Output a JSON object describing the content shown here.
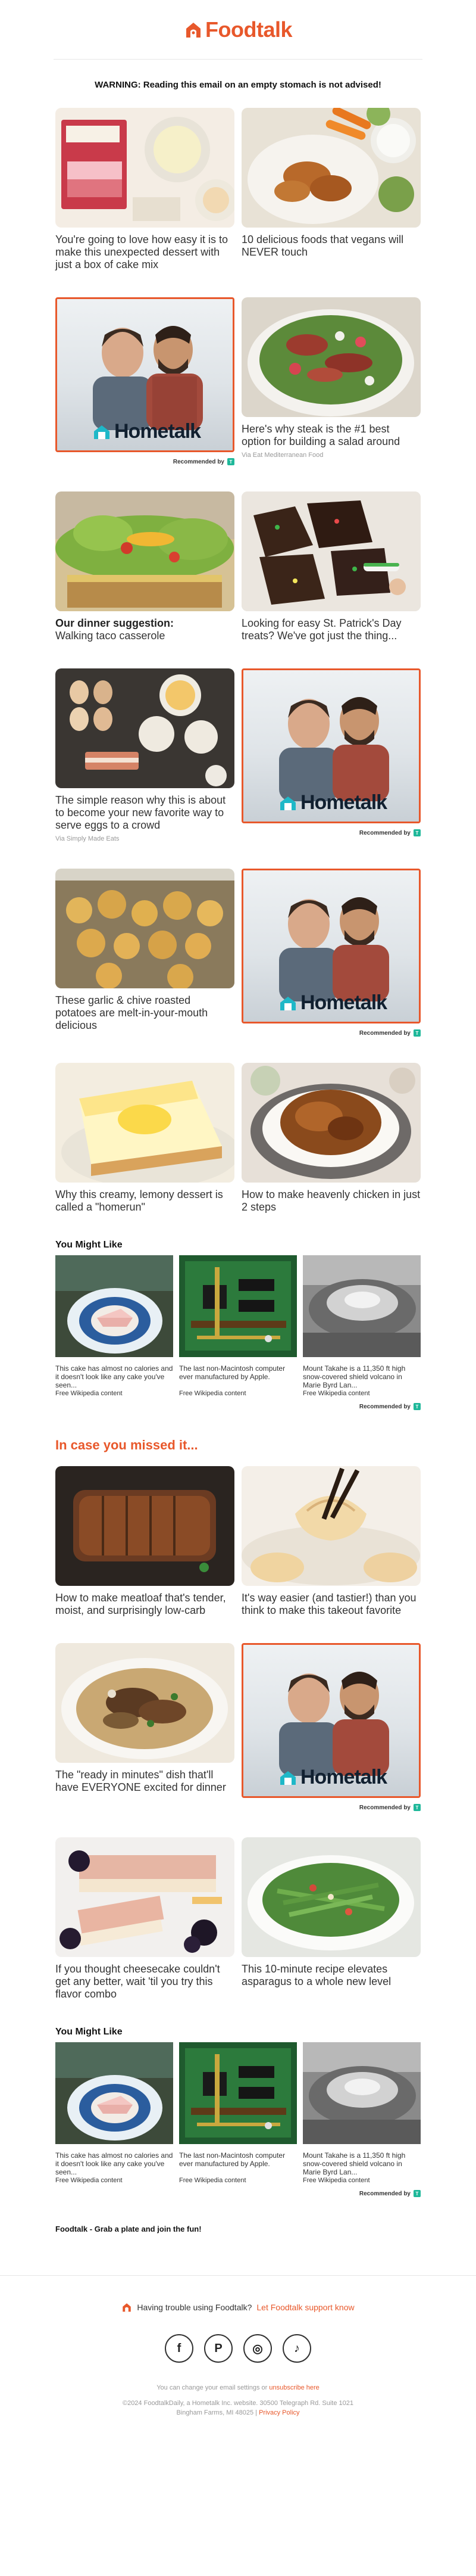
{
  "header": {
    "brand": "Foodtalk",
    "brand_color": "#e8582b",
    "warning": "WARNING: Reading this email on an empty stomach is not advised!"
  },
  "articles": [
    {
      "title": "You're going to love how easy it is to make this unexpected dessert with just a box of cake mix",
      "source": ""
    },
    {
      "title": "10 delicious foods that vegans will NEVER touch",
      "source": ""
    },
    {
      "title": "Here's why steak is the #1 best option for building a salad around",
      "source": "Via Eat Mediterranean Food"
    },
    {
      "title_bold": "Our dinner suggestion:",
      "title": "Walking taco casserole",
      "source": ""
    },
    {
      "title": "Looking for easy St. Patrick's Day treats? We've got just the thing...",
      "source": ""
    },
    {
      "title": "The simple reason why this is about to become your new favorite way to serve eggs to a crowd",
      "source": "Via Simply Made Eats"
    },
    {
      "title": "These garlic & chive roasted potatoes are melt-in-your-mouth delicious",
      "source": ""
    },
    {
      "title": "Why this creamy, lemony dessert is called a \"homerun\"",
      "source": ""
    },
    {
      "title": "How to make heavenly chicken in just 2 steps",
      "source": ""
    },
    {
      "title": "How to make meatloaf that's tender, moist, and surprisingly low-carb",
      "source": ""
    },
    {
      "title": "It's way easier (and tastier!) than you think to make this takeout favorite",
      "source": ""
    },
    {
      "title": "The \"ready in minutes\" dish that'll have EVERYONE excited for dinner",
      "source": ""
    },
    {
      "title": "If you thought cheesecake couldn't get any better, wait 'til you try this flavor combo",
      "source": ""
    },
    {
      "title": "This 10-minute recipe elevates asparagus to a whole new level",
      "source": ""
    }
  ],
  "ad": {
    "brand": "Hometalk",
    "recommended_label": "Recommended by",
    "badge": "T"
  },
  "you_might_like": {
    "title": "You Might Like",
    "items": [
      {
        "text": "This cake has almost no calories and it doesn't look like any cake you've seen...",
        "source": "Free Wikipedia content"
      },
      {
        "text": "The last non-Macintosh computer ever manufactured by Apple.",
        "source": "Free Wikipedia content"
      },
      {
        "text": "Mount Takahe is a 11,350 ft high snow-covered shield volcano in Marie Byrd Lan...",
        "source": "Free Wikipedia content"
      }
    ]
  },
  "missed_heading": "In case you missed it...",
  "footer": {
    "signoff": "Foodtalk - Grab a plate and join the fun!",
    "trouble_text": "Having trouble using Foodtalk?",
    "trouble_link": "Let Foodtalk support know",
    "socials": [
      {
        "icon": "facebook-icon",
        "glyph": "f"
      },
      {
        "icon": "pinterest-icon",
        "glyph": "P"
      },
      {
        "icon": "instagram-icon",
        "glyph": "◎"
      },
      {
        "icon": "tiktok-icon",
        "glyph": "♪"
      }
    ],
    "settings_text": "You can change your email settings or",
    "unsubscribe": "unsubscribe here",
    "copyright": "©2024 FoodtalkDaily, a Hometalk Inc. website. 30500 Telegraph Rd. Suite 1021",
    "address": "Bingham Farms, MI 48025",
    "privacy": "Privacy Policy"
  }
}
